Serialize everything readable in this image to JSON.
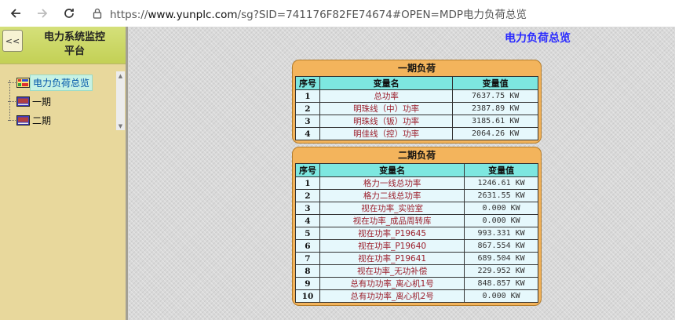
{
  "browser": {
    "url_prefix": "https://",
    "url_host": "www.yunplc.com",
    "url_rest": "/sg?SID=741176F82FE74674#OPEN=MDP电力负荷总览"
  },
  "sidebar": {
    "collapse_label": "<<",
    "title_line1": "电力系统监控",
    "title_line2": "平台",
    "items": [
      {
        "label": "电力负荷总览"
      },
      {
        "label": "一期"
      },
      {
        "label": "二期"
      }
    ]
  },
  "main": {
    "page_title": "电力负荷总览",
    "phase1": {
      "title": "一期负荷",
      "headers": {
        "idx": "序号",
        "name": "变量名",
        "value": "变量值"
      },
      "rows": [
        {
          "idx": "1",
          "name": "总功率",
          "value": "7637.75 KW"
        },
        {
          "idx": "2",
          "name": "明珠线（中）功率",
          "value": "2387.89 KW"
        },
        {
          "idx": "3",
          "name": "明珠线（钣）功率",
          "value": "3185.61 KW"
        },
        {
          "idx": "4",
          "name": "明佳线（控）功率",
          "value": "2064.26 KW"
        }
      ]
    },
    "phase2": {
      "title": "二期负荷",
      "headers": {
        "idx": "序号",
        "name": "变量名",
        "value": "变量值"
      },
      "rows": [
        {
          "idx": "1",
          "name": "格力一线总功率",
          "value": "1246.61 KW"
        },
        {
          "idx": "2",
          "name": "格力二线总功率",
          "value": "2631.55 KW"
        },
        {
          "idx": "3",
          "name": "视在功率_实验室",
          "value": "0.000 KW"
        },
        {
          "idx": "4",
          "name": "视在功率_成品周转库",
          "value": "0.000 KW"
        },
        {
          "idx": "5",
          "name": "视在功率_P19645",
          "value": "993.331 KW"
        },
        {
          "idx": "6",
          "name": "视在功率_P19640",
          "value": "867.554 KW"
        },
        {
          "idx": "7",
          "name": "视在功率_P19641",
          "value": "689.504 KW"
        },
        {
          "idx": "8",
          "name": "视在功率_无功补偿",
          "value": "229.952 KW"
        },
        {
          "idx": "9",
          "name": "总有功功率_离心机1号",
          "value": "848.857 KW"
        },
        {
          "idx": "10",
          "name": "总有功功率_离心机2号",
          "value": "0.000 KW"
        }
      ]
    }
  }
}
